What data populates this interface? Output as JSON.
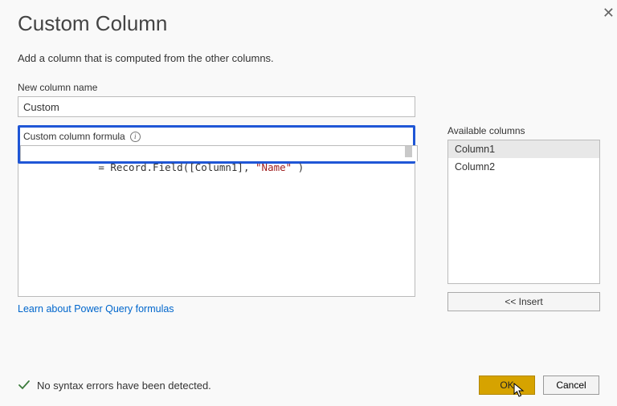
{
  "dialog": {
    "title": "Custom Column",
    "subtitle": "Add a column that is computed from the other columns.",
    "close_label": "✕"
  },
  "name": {
    "label": "New column name",
    "value": "Custom"
  },
  "formula": {
    "label": "Custom column formula",
    "equals": "= ",
    "func": "Record.Field",
    "open": "(",
    "col": "[Column1]",
    "comma": ", ",
    "str": "\"Name\"",
    "space": " ",
    "close": ")"
  },
  "available": {
    "label": "Available columns",
    "items": [
      "Column1",
      "Column2"
    ],
    "selected_index": 0,
    "insert_label": "<< Insert"
  },
  "link": {
    "text": "Learn about Power Query formulas"
  },
  "status": {
    "text": "No syntax errors have been detected."
  },
  "buttons": {
    "ok": "OK",
    "cancel": "Cancel"
  }
}
